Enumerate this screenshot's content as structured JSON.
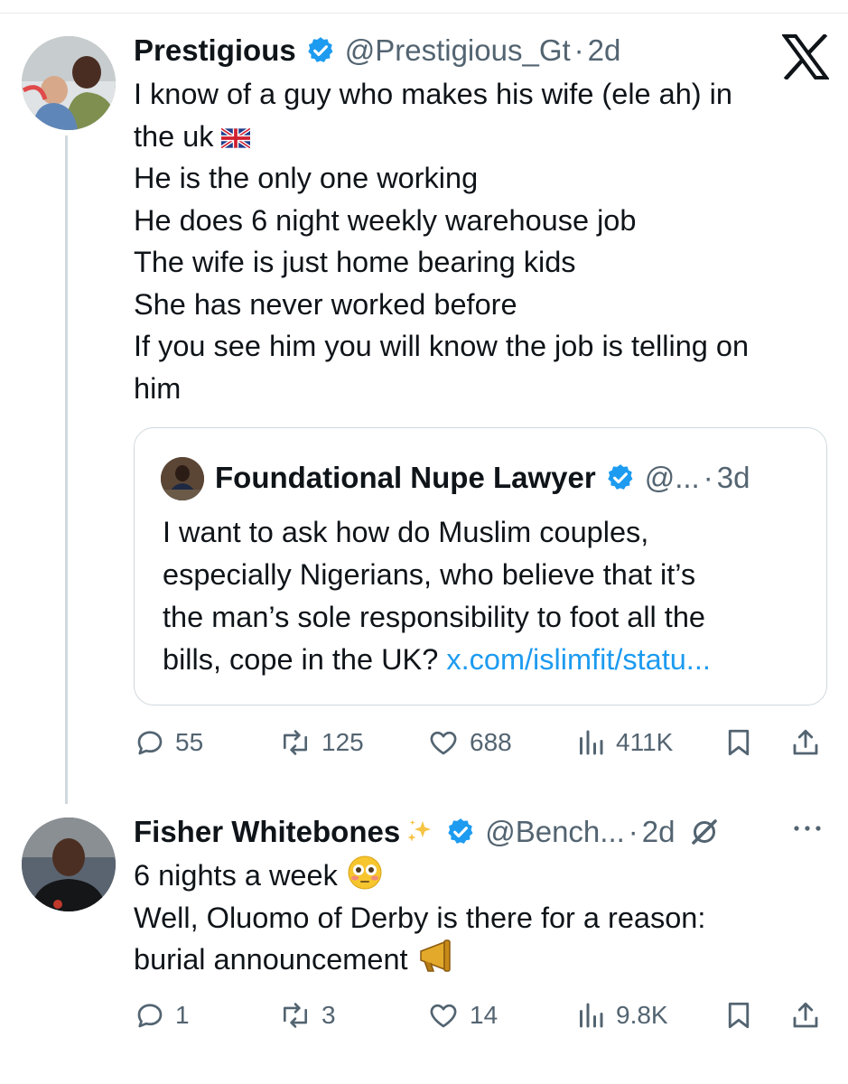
{
  "tweet1": {
    "name": "Prestigious",
    "handle": "@Prestigious_Gt",
    "separator": "·",
    "time": "2d",
    "lines": [
      "I know of a guy who makes his wife (ele ah) in",
      "the uk",
      "He is the only one working",
      "He does 6 night weekly warehouse job",
      "The wife is just home bearing kids",
      "She has never worked before",
      "If you see him you will know the job is telling on",
      "him"
    ],
    "quote": {
      "name": "Foundational Nupe Lawyer",
      "handle": "@...",
      "separator": "·",
      "time": "3d",
      "lines": [
        "I want to ask how do Muslim couples,",
        "especially Nigerians, who believe that it’s",
        "the man’s sole responsibility to foot all the"
      ],
      "last_line_text": "bills, cope in the UK?",
      "link": "x.com/islimfit/statu..."
    },
    "stats": {
      "replies": "55",
      "reposts": "125",
      "likes": "688",
      "views": "411K"
    }
  },
  "tweet2": {
    "name": "Fisher Whitebones",
    "handle": "@Bench...",
    "separator": "·",
    "time": "2d",
    "lines": [
      "6 nights a week",
      "Well, Oluomo of Derby is there for a reason:",
      "burial announcement"
    ],
    "stats": {
      "replies": "1",
      "reposts": "3",
      "likes": "14",
      "views": "9.8K"
    }
  },
  "colors": {
    "verified": "#1d9bf0",
    "link": "#1d9bf0",
    "muted": "#536471",
    "text": "#0f1419"
  },
  "icons": [
    "x-logo",
    "verified-badge-icon",
    "uk-flag-icon",
    "reply-icon",
    "repost-icon",
    "like-icon",
    "views-icon",
    "bookmark-icon",
    "share-icon",
    "sparkles-icon",
    "grok-icon",
    "more-icon",
    "flushed-face-icon",
    "megaphone-icon"
  ]
}
